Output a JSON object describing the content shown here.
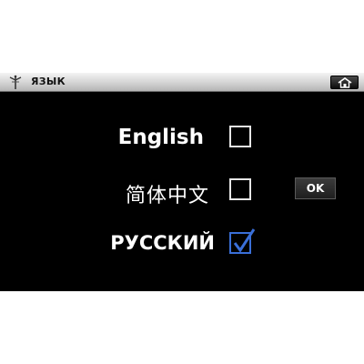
{
  "titlebar": {
    "title": "ЯЗЫК",
    "icon": "language-icon",
    "home_icon": "home-icon"
  },
  "languages": [
    {
      "label": "English",
      "checked": false
    },
    {
      "label": "简体中文",
      "checked": false
    },
    {
      "label": "РУССКИЙ",
      "checked": true
    }
  ],
  "ok_button": {
    "label": "OK"
  },
  "colors": {
    "background": "#000000",
    "text": "#ffffff",
    "checked_accent": "#3a6fd8",
    "titlebar": "#d6d6d6"
  }
}
